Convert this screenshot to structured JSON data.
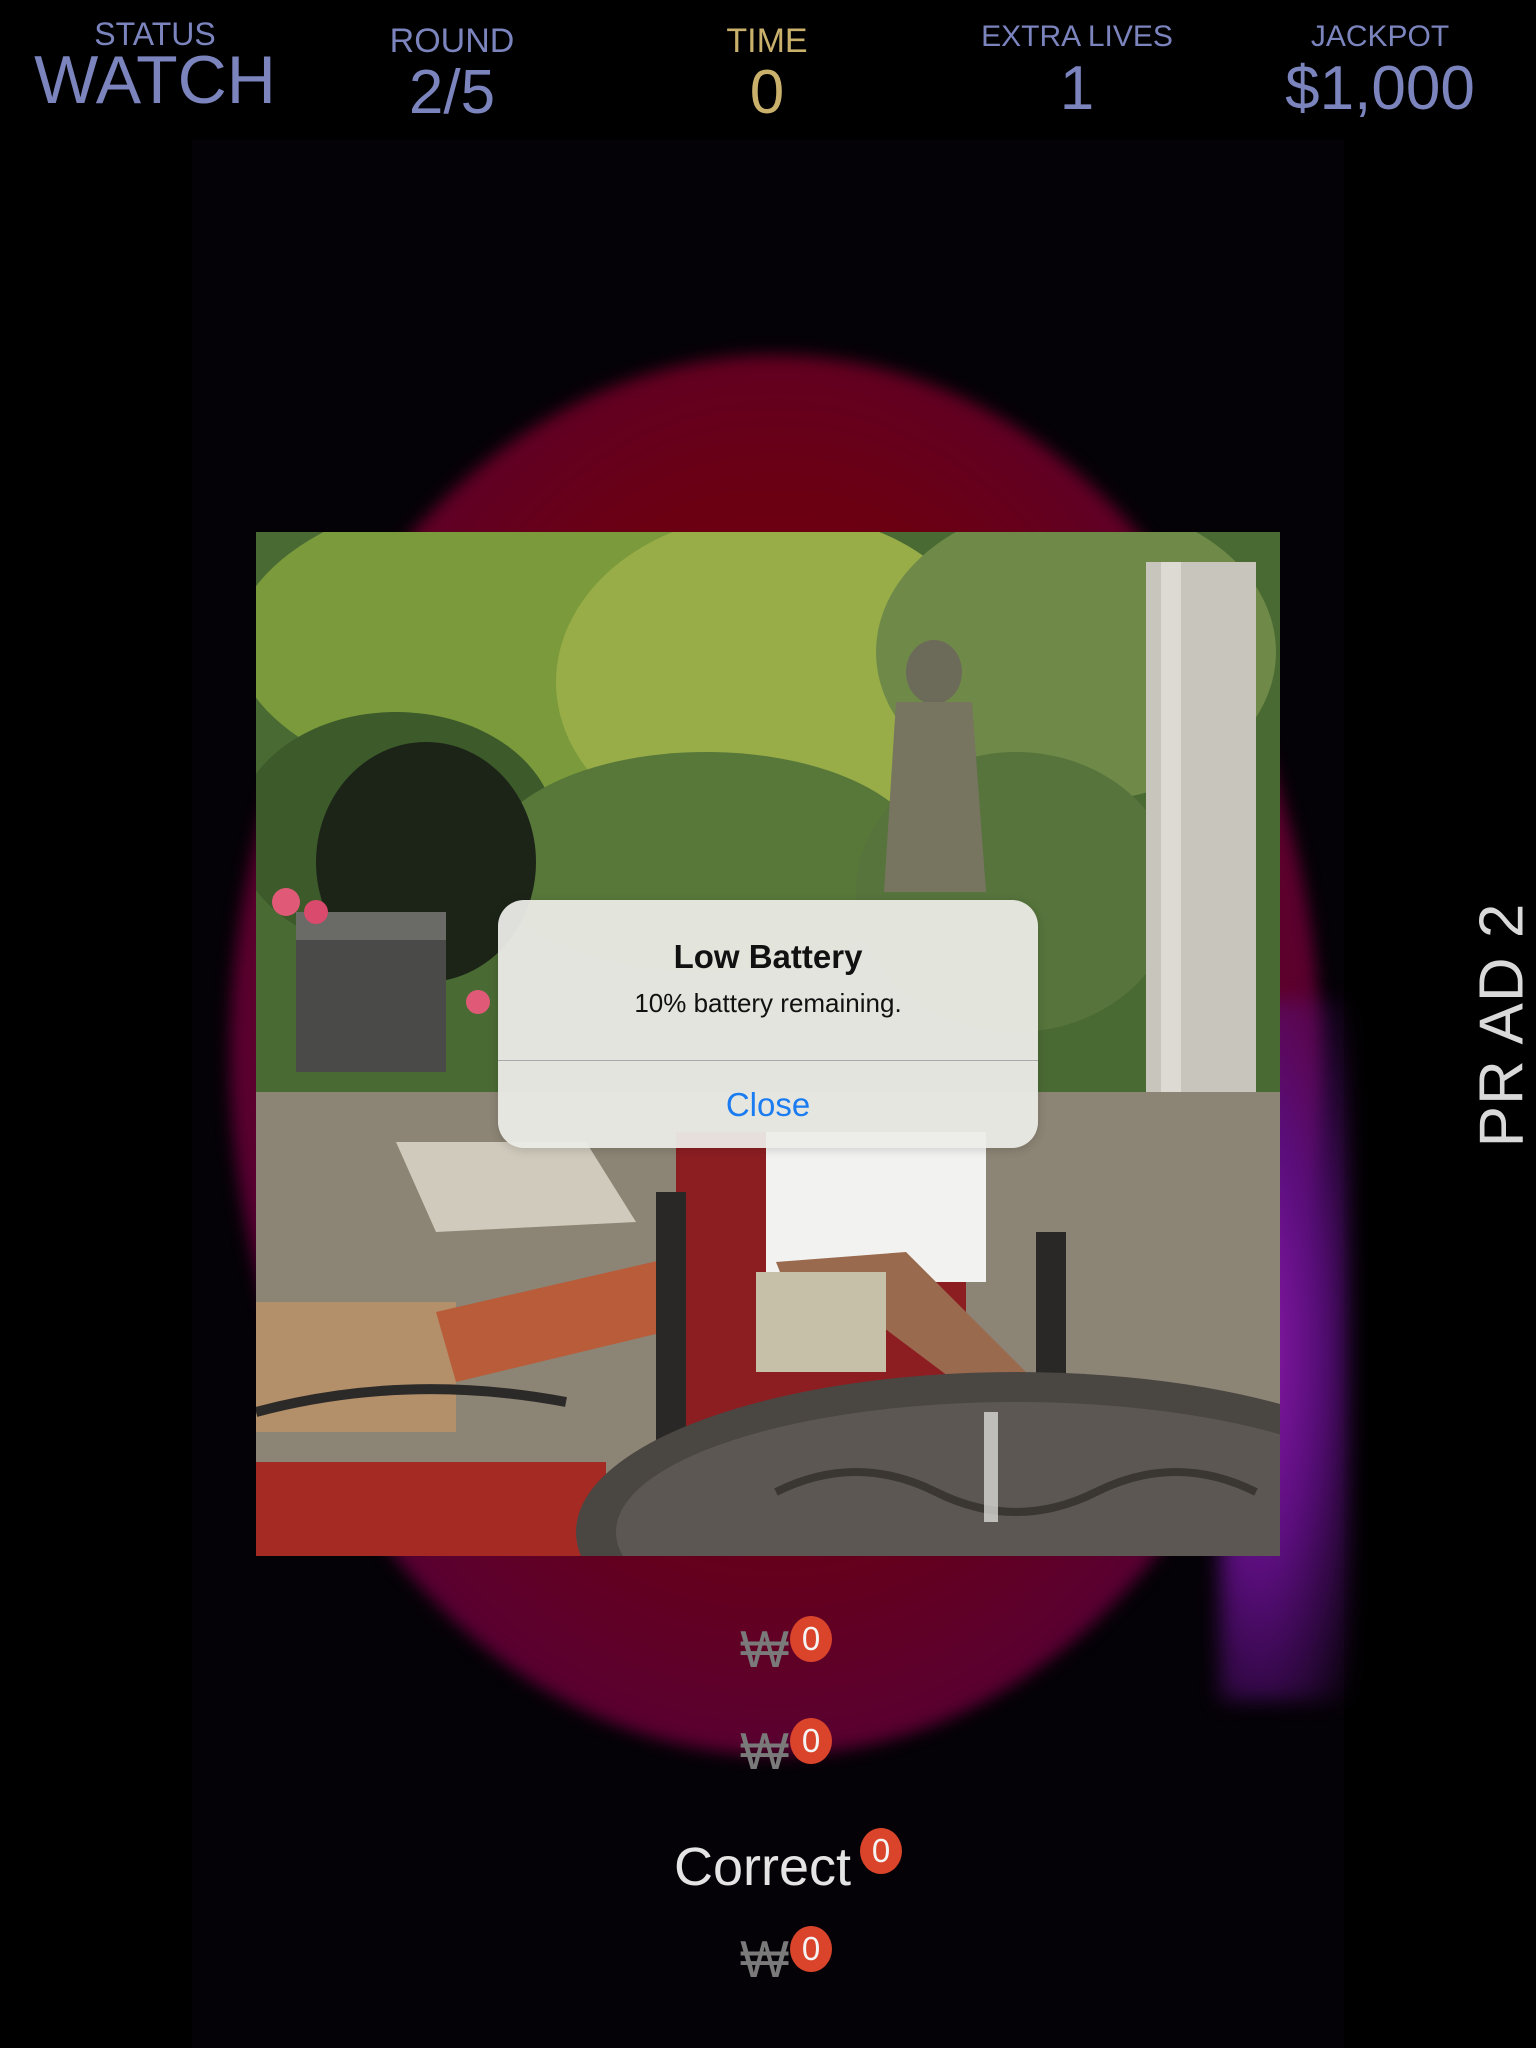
{
  "hud": {
    "status": {
      "label": "STATUS",
      "value": "WATCH"
    },
    "round": {
      "label": "ROUND",
      "value": "2/5"
    },
    "time": {
      "label": "TIME",
      "value": "0"
    },
    "extra_lives": {
      "label": "EXTRA LIVES",
      "value": "1"
    },
    "jackpot": {
      "label": "JACKPOT",
      "value": "$1,000"
    }
  },
  "player": {
    "name": "PR AD 2"
  },
  "alert": {
    "title": "Low Battery",
    "message": "10% battery remaining.",
    "button": "Close"
  },
  "answers": [
    {
      "label": "₩",
      "count": "0"
    },
    {
      "label": "₩",
      "count": "0"
    },
    {
      "label": "Correct",
      "count": "0"
    },
    {
      "label": "₩",
      "count": "0"
    }
  ],
  "colors": {
    "hud_text": "#7b84bd",
    "time_text": "#c9b16c",
    "badge": "#d9442a",
    "alert_button": "#1a7cf0"
  }
}
